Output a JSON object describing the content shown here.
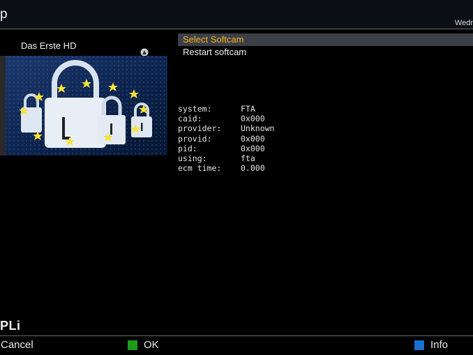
{
  "header": {
    "title": "p",
    "date": "Wedr"
  },
  "pip": {
    "channel_name": "Das Erste HD"
  },
  "menu": {
    "items": [
      {
        "label": "Select Softcam",
        "selected": true
      },
      {
        "label": "Restart softcam",
        "selected": false
      }
    ]
  },
  "info": {
    "rows": [
      {
        "key": "system:",
        "value": "FTA"
      },
      {
        "key": "caid:",
        "value": "0x000"
      },
      {
        "key": "provider:",
        "value": "Unknown"
      },
      {
        "key": "provid:",
        "value": "0x000"
      },
      {
        "key": "pid:",
        "value": "0x000"
      },
      {
        "key": "using:",
        "value": "fta"
      },
      {
        "key": "ecm time:",
        "value": "0.000"
      }
    ]
  },
  "footer": {
    "brand": "PLi",
    "cancel_label": "Cancel",
    "ok_label": "OK",
    "info_label": "Info"
  },
  "colors": {
    "selected_text": "#f5b21f",
    "selected_bg": "#3b3f47",
    "ok_key": "#1f9a1f",
    "info_key": "#1a6fd0"
  }
}
